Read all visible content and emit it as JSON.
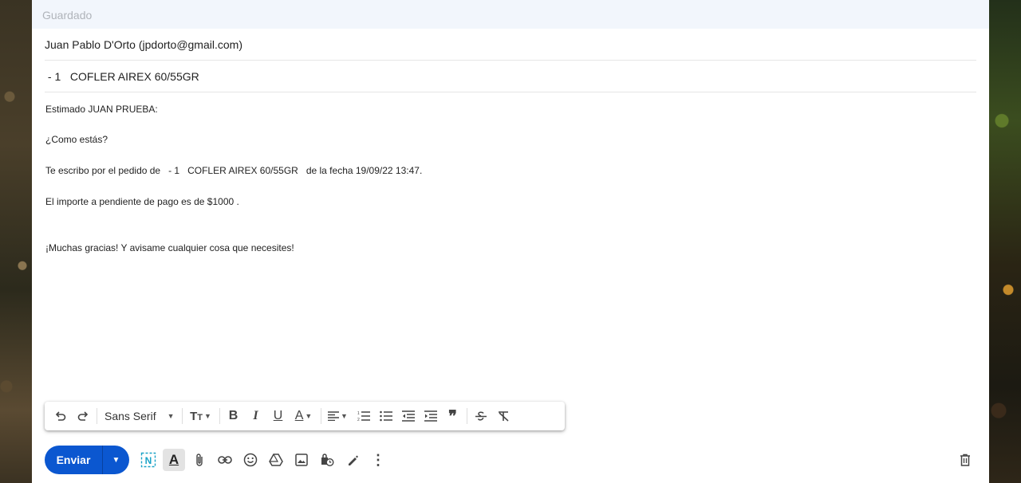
{
  "status": {
    "saved": "Guardado"
  },
  "header": {
    "to": "Juan Pablo D'Orto (jpdorto@gmail.com)",
    "subject": " - 1   COFLER AIREX 60/55GR"
  },
  "body": {
    "greeting": "Estimado JUAN PRUEBA:",
    "line1": "¿Como estás?",
    "line2": "Te escribo por el pedido de   - 1   COFLER AIREX 60/55GR   de la fecha 19/09/22 13:47.",
    "line3": "El importe a pendiente de pago es de $1000 .",
    "line4": "¡Muchas gracias! Y avisame cualquier cosa que necesites!"
  },
  "toolbar": {
    "font": "Sans Serif",
    "icons": [
      "undo-icon",
      "redo-icon",
      "text-size-icon",
      "bold-icon",
      "italic-icon",
      "underline-icon",
      "text-color-icon",
      "align-icon",
      "numbered-list-icon",
      "bulleted-list-icon",
      "indent-less-icon",
      "indent-more-icon",
      "quote-icon",
      "strikethrough-icon",
      "remove-formatting-icon"
    ]
  },
  "bottom": {
    "send_label": "Enviar",
    "icons": [
      "notion-icon",
      "formatting-options-icon",
      "attach-icon",
      "link-icon",
      "emoji-icon",
      "drive-icon",
      "photo-icon",
      "confidential-icon",
      "signature-icon",
      "more-options-icon",
      "trash-icon"
    ]
  },
  "colors": {
    "send": "#0b57d0",
    "saved_bar": "#f2f6fc",
    "notion_icon": "#1aa3c7"
  }
}
